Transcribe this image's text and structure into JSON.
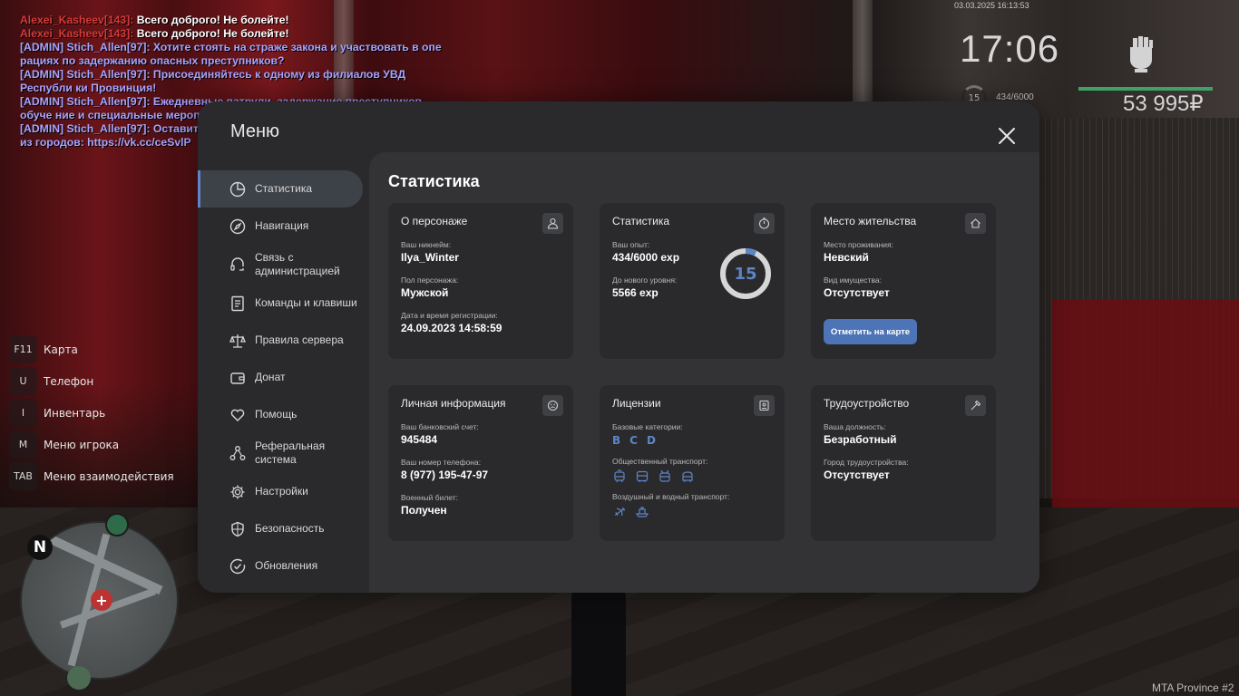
{
  "chat": [
    {
      "name": "Alexei_Kasheev[143]:",
      "text": " Всего доброго! Не болейте!",
      "type": "player"
    },
    {
      "name": "Alexei_Kasheev[143]:",
      "text": " Всего доброго! Не болейте!",
      "type": "player"
    },
    {
      "text": "[ADMIN] Stich_Allen[97]: Хотите стоять на страже закона и участвовать в опе рациях по задержанию опасных преступников?",
      "type": "admin"
    },
    {
      "text": "[ADMIN] Stich_Allen[97]: Присоединяйтесь к одному из филиалов УВД Республи ки Провинция!",
      "type": "admin"
    },
    {
      "text": "[ADMIN] Stich_Allen[97]: Ежедневные патрули, задержание преступников, обуче ние и специальные мероприятия ждут вас.",
      "type": "admin"
    },
    {
      "text": "[ADMIN] Stich_Allen[97]: Оставить заявку на трудоустройство можно в любой из  городов: https://vk.cc/ceSvlP",
      "type": "admin"
    }
  ],
  "hud": {
    "datetime": "03.03.2025 16:13:53",
    "time": "17:06",
    "level": "15",
    "exp": "434/6000",
    "money": "53 995₽",
    "hp_fraction": 1.0,
    "fist_icon": "fist-icon"
  },
  "keybinds": [
    {
      "key": "F11",
      "label": "Карта"
    },
    {
      "key": "U",
      "label": "Телефон"
    },
    {
      "key": "I",
      "label": "Инвентарь"
    },
    {
      "key": "M",
      "label": "Меню игрока"
    },
    {
      "key": "TAB",
      "label": "Меню взаимодействия"
    }
  ],
  "minimap": {
    "north": "N"
  },
  "watermark": "MTA Province #2",
  "menu": {
    "title": "Меню",
    "sidebar": [
      {
        "label": "Статистика",
        "icon": "pie-chart-icon",
        "active": true
      },
      {
        "label": "Навигация",
        "icon": "compass-icon"
      },
      {
        "label": "Связь с администрацией",
        "icon": "headset-icon"
      },
      {
        "label": "Команды и клавиши",
        "icon": "document-icon"
      },
      {
        "label": "Правила сервера",
        "icon": "scales-icon"
      },
      {
        "label": "Донат",
        "icon": "wallet-icon"
      },
      {
        "label": "Помощь",
        "icon": "heart-hand-icon"
      },
      {
        "label": "Реферальная система",
        "icon": "network-icon"
      },
      {
        "label": "Настройки",
        "icon": "gear-icon"
      },
      {
        "label": "Безопасность",
        "icon": "shield-icon"
      },
      {
        "label": "Обновления",
        "icon": "check-circle-icon"
      }
    ],
    "section_title": "Статистика",
    "cards": {
      "character": {
        "title": "О персонаже",
        "nick_label": "Ваш никнейм:",
        "nick": "Ilya_Winter",
        "gender_label": "Пол персонажа:",
        "gender": "Мужской",
        "reg_label": "Дата и время регистрации:",
        "reg": "24.09.2023 14:58:59"
      },
      "stats": {
        "title": "Статистика",
        "exp_label": "Ваш опыт:",
        "exp": "434/6000 exp",
        "next_label": "До нового уровня:",
        "next": "5566 exp",
        "level": "15",
        "level_progress": 0.0723
      },
      "residence": {
        "title": "Место жительства",
        "place_label": "Место проживания:",
        "place": "Невский",
        "property_label": "Вид имущества:",
        "property": "Отсутствует",
        "map_button": "Отметить на карте"
      },
      "personal": {
        "title": "Личная информация",
        "bank_label": "Ваш банковский счет:",
        "bank": "945484",
        "phone_label": "Ваш номер телефона:",
        "phone": "8 (977) 195-47-97",
        "military_label": "Военный билет:",
        "military": "Получен"
      },
      "licenses": {
        "title": "Лицензии",
        "base_label": "Базовые категории:",
        "base": [
          "B",
          "C",
          "D"
        ],
        "public_label": "Общественный транспорт:",
        "air_label": "Воздушный и водный транспорт:"
      },
      "job": {
        "title": "Трудоустройство",
        "position_label": "Ваша должность:",
        "position": "Безработный",
        "city_label": "Город трудоустройства:",
        "city": "Отсутствует"
      }
    }
  },
  "colors": {
    "accent": "#5d85c6",
    "button": "#4d74b6",
    "window": "#2a2a2d",
    "panel": "#333336"
  }
}
